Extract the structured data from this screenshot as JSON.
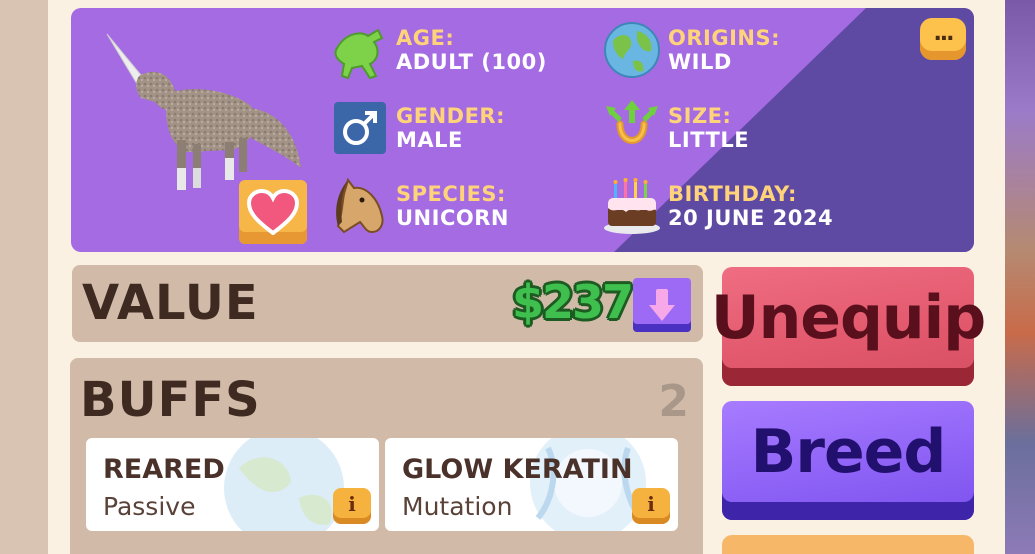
{
  "pet_info": {
    "age": {
      "label": "AGE:",
      "value": "ADULT (100)",
      "icon": "horse-leaping-icon"
    },
    "gender": {
      "label": "GENDER:",
      "value": "MALE",
      "icon": "male-sign-icon"
    },
    "species": {
      "label": "SPECIES:",
      "value": "UNICORN",
      "icon": "horse-head-icon"
    },
    "origins": {
      "label": "ORIGINS:",
      "value": "WILD",
      "icon": "globe-icon"
    },
    "size": {
      "label": "SIZE:",
      "value": "LITTLE",
      "icon": "horseshoe-arrows-icon"
    },
    "birthday": {
      "label": "BIRTHDAY:",
      "value": "20 JUNE 2024",
      "icon": "birthday-cake-icon"
    },
    "more_button": {
      "label": "...",
      "icon": "more-dots-icon"
    },
    "favorite_button": {
      "icon": "heart-icon"
    }
  },
  "value_bar": {
    "title": "VALUE",
    "amount": "$237",
    "trend_icon": "arrow-down-icon"
  },
  "buffs": {
    "title": "BUFFS",
    "count": "2",
    "items": [
      {
        "name": "REARED",
        "type": "Passive",
        "info_label": "i"
      },
      {
        "name": "GLOW KERATIN",
        "type": "Mutation",
        "info_label": "i"
      }
    ]
  },
  "actions": {
    "unequip_label": "Unequip",
    "breed_label": "Breed"
  },
  "colors": {
    "card_purple": "#a46be3",
    "label_yellow": "#ffd37a",
    "value_green": "#3fbf4d",
    "unequip_red": "#e35a6e",
    "breed_purple": "#8f63f6",
    "panel_cream": "#fbf1e3",
    "panel_tan": "#d1baa8"
  }
}
